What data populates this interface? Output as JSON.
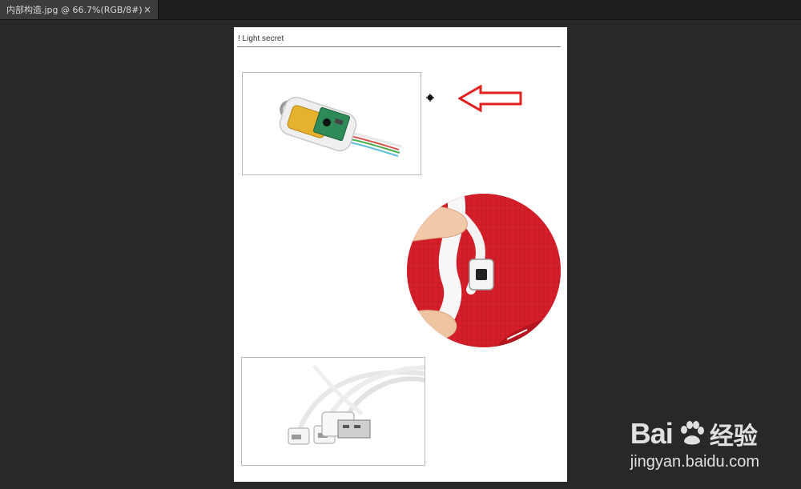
{
  "tab": {
    "title": "内部构造.jpg @ 66.7%(RGB/8#)",
    "close_label": "×"
  },
  "document": {
    "header_text": "! Light secret"
  },
  "annotation": {
    "arrow_color": "#e0211d",
    "arrow_direction": "left"
  },
  "watermark": {
    "brand_left": "Bai",
    "brand_right": "经验",
    "url": "jingyan.baidu.com"
  },
  "colors": {
    "workspace_bg": "#282828",
    "tabbar_bg": "#1e1e1e",
    "active_tab_bg": "#3c3c3c",
    "document_bg": "#ffffff",
    "fabric_red": "#d61f2a"
  }
}
